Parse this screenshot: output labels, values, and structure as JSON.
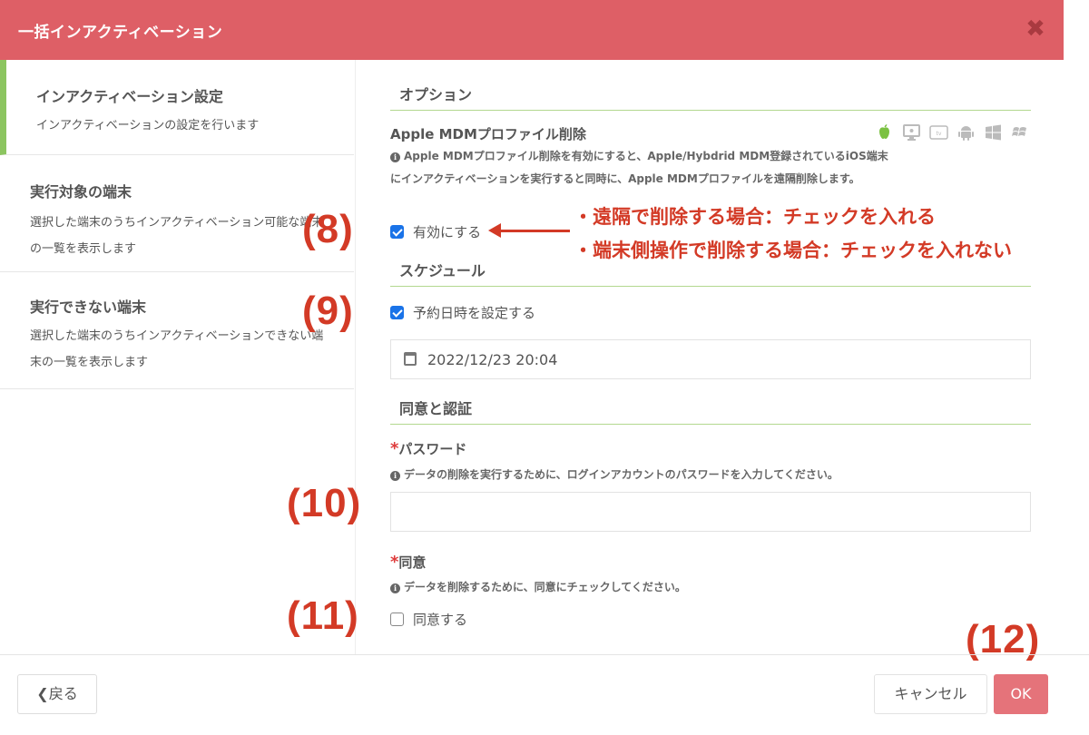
{
  "dialog": {
    "title": "一括インアクティベーション",
    "close_icon": "close-icon"
  },
  "sidebar": {
    "items": [
      {
        "title": "インアクティベーション設定",
        "desc": "インアクティベーションの設定を行います",
        "active": true
      },
      {
        "title": "実行対象の端末",
        "desc": "選択した端末のうちインアクティベーション可能な端末の一覧を表示します",
        "active": false
      },
      {
        "title": "実行できない端末",
        "desc": "選択した端末のうちインアクティベーションできない端末の一覧を表示します",
        "active": false
      }
    ]
  },
  "options": {
    "section_title": "オプション",
    "mdm_label": "Apple MDMプロファイル削除",
    "mdm_help": "Apple MDMプロファイル削除を有効にすると、Apple/Hybdrid MDM登録されているiOS端末にインアクティベーションを実行すると同時に、Apple MDMプロファイルを遠隔削除します。",
    "enable_label": "有効にする",
    "enable_checked": true,
    "os_icons": [
      "apple-icon",
      "macos-icon",
      "appletv-icon",
      "android-icon",
      "windows-icon",
      "windows-legacy-icon"
    ]
  },
  "schedule": {
    "section_title": "スケジュール",
    "reserve_label": "予約日時を設定する",
    "reserve_checked": true,
    "datetime": "2022/12/23 20:04"
  },
  "consent": {
    "section_title": "同意と認証",
    "password_label": "パスワード",
    "password_help": "データの削除を実行するために、ログインアカウントのパスワードを入力してください。",
    "password_value": "",
    "agree_label": "同意",
    "agree_help": "データを削除するために、同意にチェックしてください。",
    "agree_checkbox_label": "同意する",
    "agree_checked": false,
    "required_mark": "*"
  },
  "annotations": {
    "n8": "(8)",
    "n9": "(9)",
    "n10": "(10)",
    "n11": "(11)",
    "n12": "(12)",
    "note1": "・遠隔で削除する場合：チェックを入れる",
    "note2": "・端末側操作で削除する場合：チェックを入れない"
  },
  "footer": {
    "back_label": "戻る",
    "cancel_label": "キャンセル",
    "ok_label": "OK"
  },
  "colors": {
    "header": "#de5f66",
    "accent_green": "#8cc560",
    "ok_button": "#e5737a",
    "annotation": "#d33a26"
  }
}
